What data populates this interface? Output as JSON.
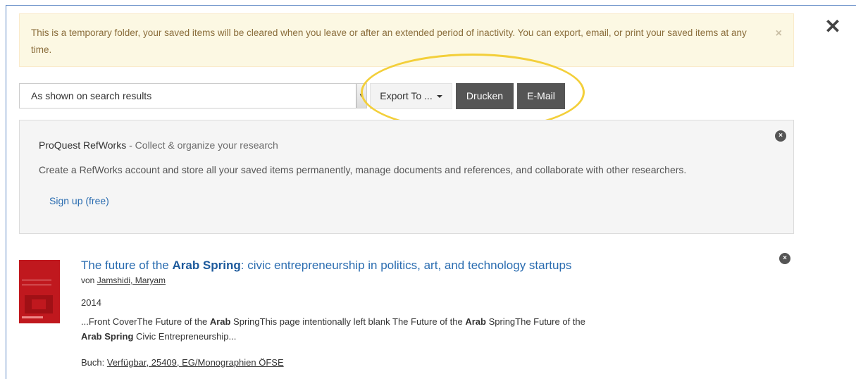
{
  "window": {
    "close_glyph": "✕"
  },
  "alert": {
    "message": "This is a temporary folder, your saved items will be cleared when you leave or after an extended period of inactivity. You can export, email, or print your saved items at any time.",
    "close_glyph": "×"
  },
  "toolbar": {
    "format_select_value": "As shown on search results",
    "export_label": "Export To ...",
    "print_label": "Drucken",
    "email_label": "E-Mail"
  },
  "refworks": {
    "title": "ProQuest RefWorks",
    "subtitle": " - Collect & organize your research",
    "description": "Create a RefWorks account and store all your saved items permanently, manage documents and references, and collaborate with other researchers.",
    "signup_label": "Sign up (free)",
    "close_glyph": "×"
  },
  "item": {
    "title_prefix": "The future of the ",
    "title_bold": "Arab Spring",
    "title_suffix": ": civic entrepreneurship in politics, art, and technology startups",
    "by_label": "von ",
    "author": "Jamshidi, Maryam",
    "year": "2014",
    "snippet": {
      "p1": "...Front CoverThe Future of the ",
      "b1": "Arab",
      "p2": " SpringThis page intentionally left blank The Future of the ",
      "b2": "Arab",
      "p3": " SpringThe Future of the ",
      "b3": "Arab Spring",
      "p4": " Civic Entrepreneurship..."
    },
    "status_label": "Buch: ",
    "status_location": "Verfügbar, 25409, EG/Monographien ÖFSE",
    "close_glyph": "×"
  },
  "colors": {
    "alert_bg": "#fcf8e3",
    "alert_text": "#8a6d3b",
    "link": "#2a6cb0",
    "dark_button": "#555555",
    "highlight": "#f3cf3a",
    "cover": "#c0181e"
  },
  "icons": {
    "window_close": "close-icon",
    "alert_close": "close-icon",
    "export_caret": "caret-down-icon",
    "dismiss": "circle-close-icon"
  }
}
